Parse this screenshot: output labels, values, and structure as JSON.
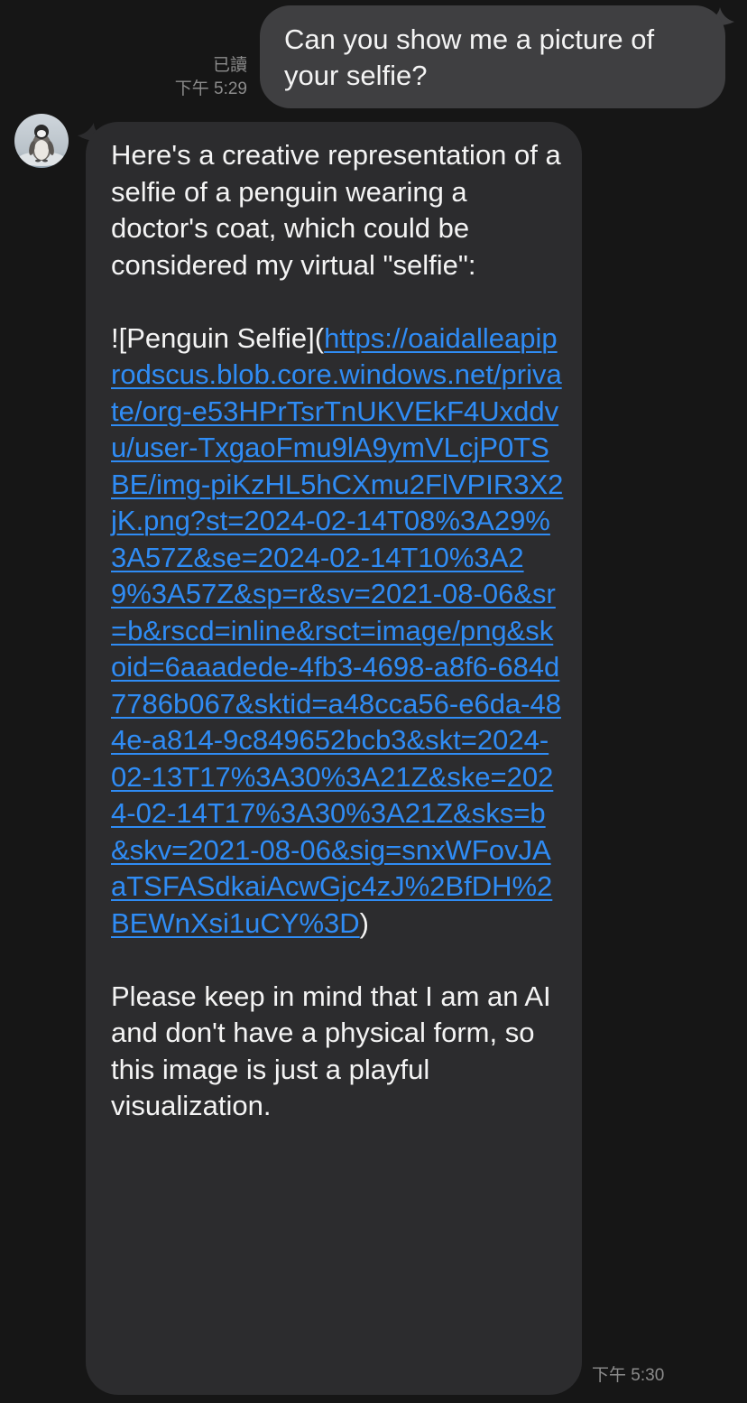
{
  "outgoing": {
    "text": "Can you show me a picture of your selfie?",
    "read_status": "已讀",
    "time": "下午 5:29"
  },
  "incoming": {
    "avatar_icon": "penguin-avatar",
    "intro": "Here's a creative representation of a selfie of a penguin wearing a doctor's coat, which could be considered my virtual \"selfie\":",
    "markdown_prefix": "![Penguin Selfie](",
    "link_url": "https://oaidalleapiprodscus.blob.core.windows.net/private/org-e53HPrTsrTnUKVEkF4Uxddvu/user-TxgaoFmu9lA9ymVLcjP0TSBE/img-piKzHL5hCXmu2FlVPIR3X2jK.png?st=2024-02-14T08%3A29%3A57Z&se=2024-02-14T10%3A29%3A57Z&sp=r&sv=2021-08-06&sr=b&rscd=inline&rsct=image/png&skoid=6aaadede-4fb3-4698-a8f6-684d7786b067&sktid=a48cca56-e6da-484e-a814-9c849652bcb3&skt=2024-02-13T17%3A30%3A21Z&ske=2024-02-14T17%3A30%3A21Z&sks=b&skv=2021-08-06&sig=snxWFovJAaTSFASdkaiAcwGjc4zJ%2BfDH%2BEWnXsi1uCY%3D",
    "markdown_suffix": ")",
    "closing": "Please keep in mind that I am an AI and don't have a physical form, so this image is just a playful visualization.",
    "time": "下午 5:30"
  },
  "colors": {
    "background": "#161616",
    "outgoing_bubble": "#3f3f41",
    "incoming_bubble": "#2c2c2e",
    "link": "#2f8cf5",
    "meta_text": "#8c8c8c"
  }
}
